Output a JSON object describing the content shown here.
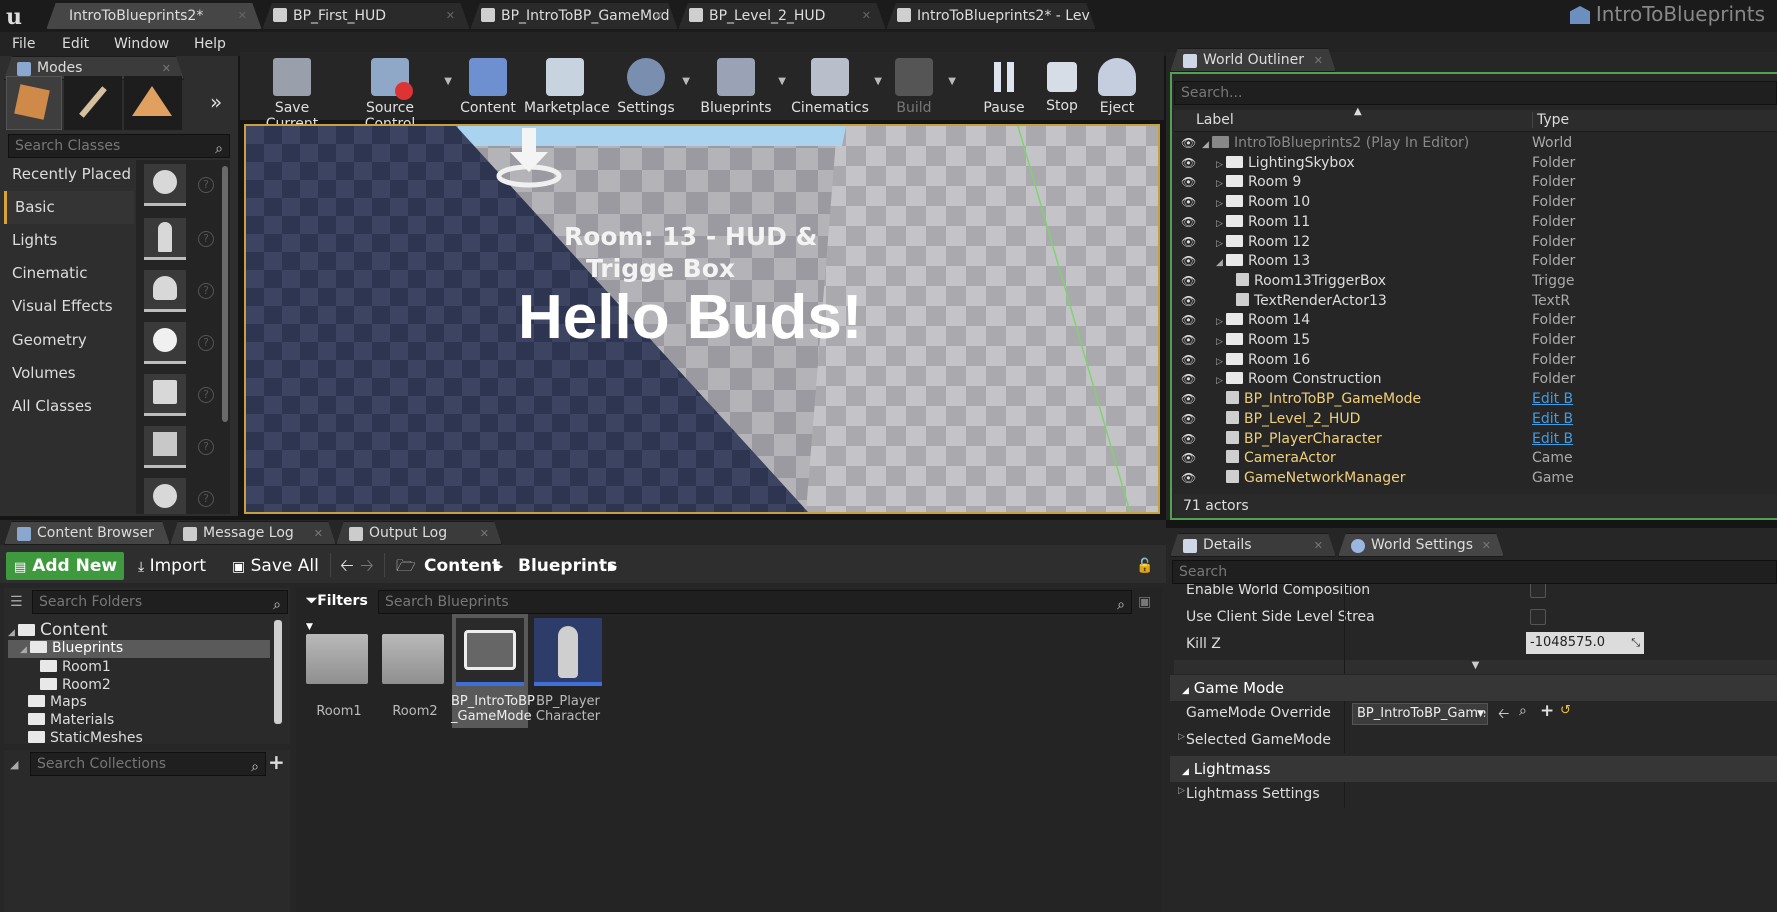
{
  "title_bar": {
    "app_title": "IntroToBlueprints",
    "tabs": [
      {
        "label": "IntroToBlueprints2*",
        "active": true
      },
      {
        "label": "BP_First_HUD",
        "active": false
      },
      {
        "label": "BP_IntroToBP_GameMod",
        "active": false
      },
      {
        "label": "BP_Level_2_HUD",
        "active": false
      },
      {
        "label": "IntroToBlueprints2* - Lev",
        "active": false
      }
    ]
  },
  "menu": {
    "file": "File",
    "edit": "Edit",
    "window": "Window",
    "help": "Help"
  },
  "modes": {
    "tab_label": "Modes",
    "search_placeholder": "Search Classes",
    "categories": [
      "Recently Placed",
      "Basic",
      "Lights",
      "Cinematic",
      "Visual Effects",
      "Geometry",
      "Volumes",
      "All Classes"
    ],
    "selected_category": "Basic"
  },
  "toolbar": {
    "save_current": "Save Current",
    "source_control": "Source Control",
    "content": "Content",
    "marketplace": "Marketplace",
    "settings": "Settings",
    "blueprints": "Blueprints",
    "cinematics": "Cinematics",
    "build": "Build",
    "pause": "Pause",
    "stop": "Stop",
    "eject": "Eject"
  },
  "viewport": {
    "room_text_line1": "Room: 13 - HUD &",
    "room_text_line2": "Trigge Box",
    "hello_text": "Hello Buds!"
  },
  "outliner": {
    "tab_label": "World Outliner",
    "search_placeholder": "Search...",
    "col_label": "Label",
    "col_type": "Type",
    "rows": [
      {
        "label": "IntroToBlueprints2 (Play In Editor)",
        "type": "World",
        "kind": "world"
      },
      {
        "label": "LightingSkybox",
        "type": "Folder",
        "kind": "folder"
      },
      {
        "label": "Room 9",
        "type": "Folder",
        "kind": "folder"
      },
      {
        "label": "Room 10",
        "type": "Folder",
        "kind": "folder"
      },
      {
        "label": "Room 11",
        "type": "Folder",
        "kind": "folder"
      },
      {
        "label": "Room 12",
        "type": "Folder",
        "kind": "folder"
      },
      {
        "label": "Room 13",
        "type": "Folder",
        "kind": "folder-open"
      },
      {
        "label": "Room13TriggerBox",
        "type": "Trigge",
        "kind": "child"
      },
      {
        "label": "TextRenderActor13",
        "type": "TextR",
        "kind": "child"
      },
      {
        "label": "Room 14",
        "type": "Folder",
        "kind": "folder"
      },
      {
        "label": "Room 15",
        "type": "Folder",
        "kind": "folder"
      },
      {
        "label": "Room 16",
        "type": "Folder",
        "kind": "folder"
      },
      {
        "label": "Room Construction",
        "type": "Folder",
        "kind": "folder"
      },
      {
        "label": "BP_IntroToBP_GameMode",
        "type": "Edit B",
        "kind": "bp"
      },
      {
        "label": "BP_Level_2_HUD",
        "type": "Edit B",
        "kind": "bp"
      },
      {
        "label": "BP_PlayerCharacter",
        "type": "Edit B",
        "kind": "bp"
      },
      {
        "label": "CameraActor",
        "type": "Came",
        "kind": "bp"
      },
      {
        "label": "GameNetworkManager",
        "type": "Game",
        "kind": "bp"
      }
    ],
    "actor_count": "71 actors"
  },
  "bottom_tabs": {
    "content_browser": "Content Browser",
    "message_log": "Message Log",
    "output_log": "Output Log"
  },
  "content_browser": {
    "add_new": "Add New",
    "import": "Import",
    "save_all": "Save All",
    "path_content": "Content",
    "path_blueprints": "Blueprints",
    "search_folders_placeholder": "Search Folders",
    "filters": "Filters",
    "search_blueprints_placeholder": "Search Blueprints",
    "search_collections_placeholder": "Search Collections",
    "tree": [
      "Content",
      "Blueprints",
      "Room1",
      "Room2",
      "Maps",
      "Materials",
      "StaticMeshes"
    ],
    "assets": [
      {
        "label": "Room1",
        "kind": "folder"
      },
      {
        "label": "Room2",
        "kind": "folder"
      },
      {
        "label": "BP_IntroToBP\n_GameMode",
        "kind": "gamemode"
      },
      {
        "label": "BP_Player\nCharacter",
        "kind": "character"
      }
    ]
  },
  "details": {
    "details_tab": "Details",
    "world_settings_tab": "World Settings",
    "search_placeholder": "Search",
    "enable_world_composition": "Enable World Composition",
    "use_client_side": "Use Client Side Level Strea",
    "kill_z_label": "Kill Z",
    "kill_z_value": "-1048575.0",
    "game_mode_section": "Game Mode",
    "gamemode_override_label": "GameMode Override",
    "gamemode_override_value": "BP_IntroToBP_Game",
    "selected_gamemode": "Selected GameMode",
    "lightmass_section": "Lightmass",
    "lightmass_settings": "Lightmass Settings"
  },
  "colors": {
    "accent": "#d7a23a",
    "add_new_green": "#3f9a3f",
    "link": "#3f9de6",
    "bp_name": "#f0cf7a"
  }
}
